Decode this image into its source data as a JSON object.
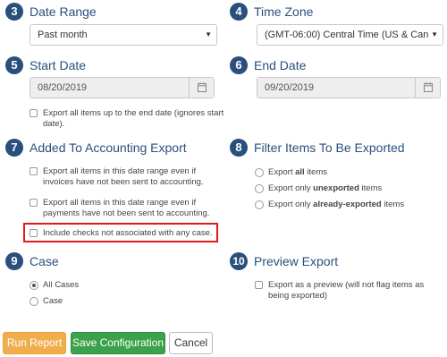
{
  "sections": {
    "date_range": {
      "number": "3",
      "title": "Date Range",
      "value": "Past month"
    },
    "time_zone": {
      "number": "4",
      "title": "Time Zone",
      "value": "(GMT-06:00) Central Time (US & Can"
    },
    "start_date": {
      "number": "5",
      "title": "Start Date",
      "value": "08/20/2019",
      "export_all_label": "Export all items up to the end date (ignores start date)."
    },
    "end_date": {
      "number": "6",
      "title": "End Date",
      "value": "09/20/2019"
    },
    "accounting": {
      "number": "7",
      "title": "Added To Accounting Export",
      "options": [
        "Export all items in this date range even if invoices have not been sent to accounting.",
        "Export all items in this date range even if payments have not been sent to accounting.",
        "Include checks not associated with any case."
      ]
    },
    "filter": {
      "number": "8",
      "title": "Filter Items To Be Exported",
      "options": [
        {
          "prefix": "Export ",
          "bold": "all",
          "suffix": " items"
        },
        {
          "prefix": "Export only ",
          "bold": "unexported",
          "suffix": " items"
        },
        {
          "prefix": "Export only ",
          "bold": "already-exported",
          "suffix": " items"
        }
      ]
    },
    "case": {
      "number": "9",
      "title": "Case",
      "options": [
        "All Cases",
        "Case"
      ],
      "selected": "All Cases"
    },
    "preview": {
      "number": "10",
      "title": "Preview Export",
      "option": "Export as a preview (will not flag items as being exported)"
    }
  },
  "buttons": {
    "run": "Run Report",
    "save": "Save Configuration",
    "cancel": "Cancel"
  },
  "colors": {
    "accent": "#2a4f7c",
    "run": "#f0ad4e",
    "save": "#3aa24a",
    "highlight": "#e01b1b"
  }
}
